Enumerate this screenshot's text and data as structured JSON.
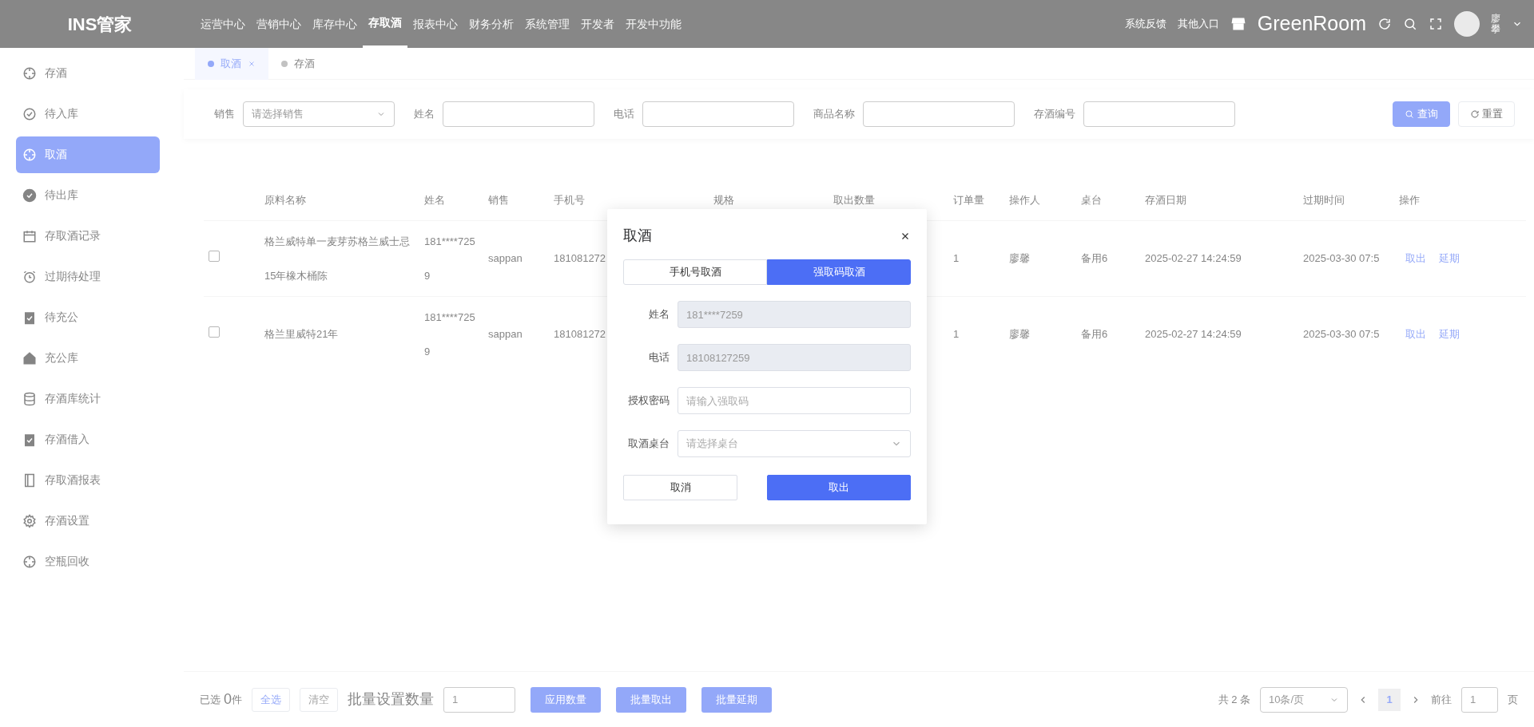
{
  "header": {
    "logo": "INS管家",
    "nav": [
      {
        "label": "运营中心",
        "selected": false
      },
      {
        "label": "营销中心",
        "selected": false
      },
      {
        "label": "库存中心",
        "selected": false
      },
      {
        "label": "存取酒",
        "selected": true
      },
      {
        "label": "报表中心",
        "selected": false
      },
      {
        "label": "财务分析",
        "selected": false
      },
      {
        "label": "系统管理",
        "selected": false
      },
      {
        "label": "开发者",
        "selected": false
      },
      {
        "label": "开发中功能",
        "selected": false
      }
    ],
    "links": [
      "系统反馈",
      "其他入口"
    ],
    "store_name": "GreenRoom",
    "user_name": "廖攀"
  },
  "sidebar": {
    "items": [
      {
        "label": "存酒",
        "selected": false
      },
      {
        "label": "待入库",
        "selected": false
      },
      {
        "label": "取酒",
        "selected": true
      },
      {
        "label": "待出库",
        "selected": false
      },
      {
        "label": "存取酒记录",
        "selected": false
      },
      {
        "label": "过期待处理",
        "selected": false
      },
      {
        "label": "待充公",
        "selected": false
      },
      {
        "label": "充公库",
        "selected": false
      },
      {
        "label": "存酒库统计",
        "selected": false
      },
      {
        "label": "存酒借入",
        "selected": false
      },
      {
        "label": "存取酒报表",
        "selected": false
      },
      {
        "label": "存酒设置",
        "selected": false
      },
      {
        "label": "空瓶回收",
        "selected": false
      }
    ]
  },
  "tabs": [
    {
      "label": "取酒",
      "selected": true,
      "closable": true
    },
    {
      "label": "存酒",
      "selected": false,
      "closable": false
    }
  ],
  "filters": [
    {
      "label": "销售",
      "kind": "select",
      "placeholder": "请选择销售"
    },
    {
      "label": "姓名",
      "kind": "input"
    },
    {
      "label": "电话",
      "kind": "input"
    },
    {
      "label": "商品名称",
      "kind": "input"
    },
    {
      "label": "存酒编号",
      "kind": "input"
    }
  ],
  "filter_buttons": [
    {
      "label": "查询",
      "kind": "primary"
    },
    {
      "label": "重置",
      "kind": "plain"
    }
  ],
  "table": {
    "columns": [
      "原料名称",
      "姓名",
      "销售",
      "手机号",
      "规格",
      "取出数量",
      "订单量",
      "操作人",
      "桌台",
      "存酒日期",
      "过期时间",
      "操作"
    ],
    "rows": [
      {
        "checked": false,
        "material": "格兰威特单一麦芽苏格兰威士忌15年橡木桶陈",
        "name": "181****7259",
        "sales": "sappan",
        "phone": "181081272",
        "order_qty": "1",
        "operator": "廖馨",
        "table": "备用6",
        "stored_at": "2025-02-27 14:24:59",
        "expires_at": "2025-03-30 07:5",
        "actions": [
          "取出",
          "延期"
        ]
      },
      {
        "checked": false,
        "material": "格兰里威特21年",
        "name": "181****7259",
        "sales": "sappan",
        "phone": "181081272",
        "order_qty": "1",
        "operator": "廖馨",
        "table": "备用6",
        "stored_at": "2025-02-27 14:24:59",
        "expires_at": "2025-03-30 07:5",
        "actions": [
          "取出",
          "延期"
        ]
      }
    ]
  },
  "footer": {
    "selected_label": "已选",
    "selected_count": "0",
    "selected_unit": "件",
    "select_all": "全选",
    "clear": "清空",
    "batch_label": "批量设置数量",
    "batch_value": "1",
    "buttons": [
      "应用数量",
      "批量取出",
      "批量延期"
    ],
    "pagination": {
      "total": "共 2 条",
      "page_size": "10条/页",
      "pages": [
        {
          "label": "1",
          "selected": true
        }
      ],
      "goto_label": "前往",
      "goto_value": "1",
      "goto_unit": "页"
    }
  },
  "dialog": {
    "title": "取酒",
    "tabs": [
      {
        "label": "手机号取酒",
        "selected": false
      },
      {
        "label": "强取码取酒",
        "selected": true
      }
    ],
    "fields": [
      {
        "label": "姓名",
        "kind": "input",
        "value": "181****7259",
        "disabled": true
      },
      {
        "label": "电话",
        "kind": "input",
        "value": "18108127259",
        "disabled": true
      },
      {
        "label": "授权密码",
        "kind": "input",
        "placeholder": "请输入强取码",
        "disabled": false
      },
      {
        "label": "取酒桌台",
        "kind": "select",
        "placeholder": "请选择桌台",
        "disabled": false
      }
    ],
    "buttons": [
      {
        "label": "取消",
        "kind": "plain"
      },
      {
        "label": "取出",
        "kind": "primary"
      }
    ]
  }
}
